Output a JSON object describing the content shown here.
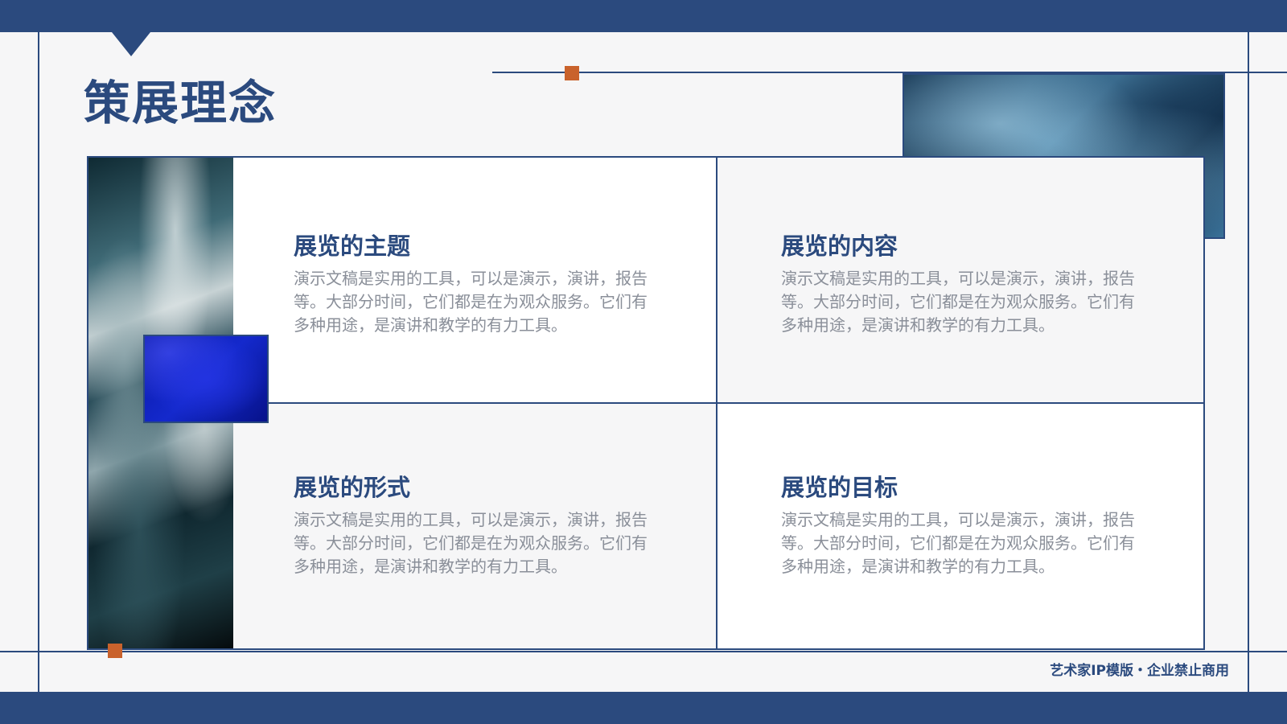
{
  "page": {
    "title": "策展理念",
    "footer_note": "艺术家IP模版・企业禁止商用"
  },
  "cards": [
    {
      "title": "展览的主题",
      "description": "演示文稿是实用的工具，可以是演示，演讲，报告等。大部分时间，它们都是在为观众服务。它们有多种用途，是演讲和教学的有力工具。"
    },
    {
      "title": "展览的内容",
      "description": "演示文稿是实用的工具，可以是演示，演讲，报告等。大部分时间，它们都是在为观众服务。它们有多种用途，是演讲和教学的有力工具。"
    },
    {
      "title": "展览的形式",
      "description": "演示文稿是实用的工具，可以是演示，演讲，报告等。大部分时间，它们都是在为观众服务。它们有多种用途，是演讲和教学的有力工具。"
    },
    {
      "title": "展览的目标",
      "description": "演示文稿是实用的工具，可以是演示，演讲，报告等。大部分时间，它们都是在为观众服务。它们有多种用途，是演讲和教学的有力工具。"
    }
  ],
  "colors": {
    "primary": "#2b4a7e",
    "accent": "#c9622c",
    "text_muted": "#8a8f99",
    "background": "#f6f6f7"
  }
}
